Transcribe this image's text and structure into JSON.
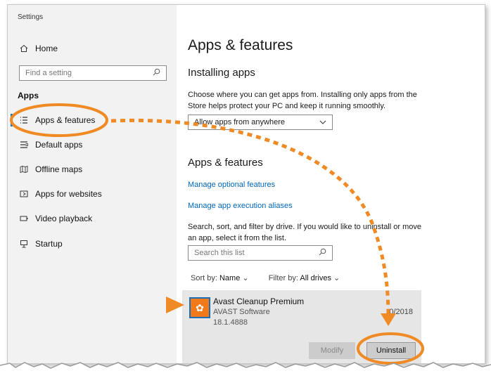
{
  "window": {
    "title": "Settings"
  },
  "sidebar": {
    "home_label": "Home",
    "find_placeholder": "Find a setting",
    "section_label": "Apps",
    "items": [
      {
        "label": "Apps & features",
        "icon": "list-icon"
      },
      {
        "label": "Default apps",
        "icon": "default-apps-icon"
      },
      {
        "label": "Offline maps",
        "icon": "map-icon"
      },
      {
        "label": "Apps for websites",
        "icon": "web-apps-icon"
      },
      {
        "label": "Video playback",
        "icon": "video-icon"
      },
      {
        "label": "Startup",
        "icon": "startup-icon"
      }
    ]
  },
  "main": {
    "page_title": "Apps & features",
    "installing": {
      "heading": "Installing apps",
      "description": "Choose where you can get apps from. Installing only apps from the Store helps protect your PC and keep it running smoothly.",
      "dropdown_value": "Allow apps from anywhere"
    },
    "features": {
      "heading": "Apps & features",
      "link_optional": "Manage optional features",
      "link_aliases": "Manage app execution aliases",
      "description": "Search, sort, and filter by drive. If you would like to uninstall or move an app, select it from the list.",
      "search_placeholder": "Search this list",
      "sort_label": "Sort by:",
      "sort_value": "Name",
      "filter_label": "Filter by:",
      "filter_value": "All drives"
    },
    "app": {
      "name": "Avast Cleanup Premium",
      "publisher": "AVAST Software",
      "version": "18.1.4888",
      "date": "0/2018",
      "modify_label": "Modify",
      "uninstall_label": "Uninstall"
    }
  },
  "colors": {
    "accent": "#0078d7",
    "link": "#0067b8",
    "annotation_orange": "#f08a24"
  }
}
